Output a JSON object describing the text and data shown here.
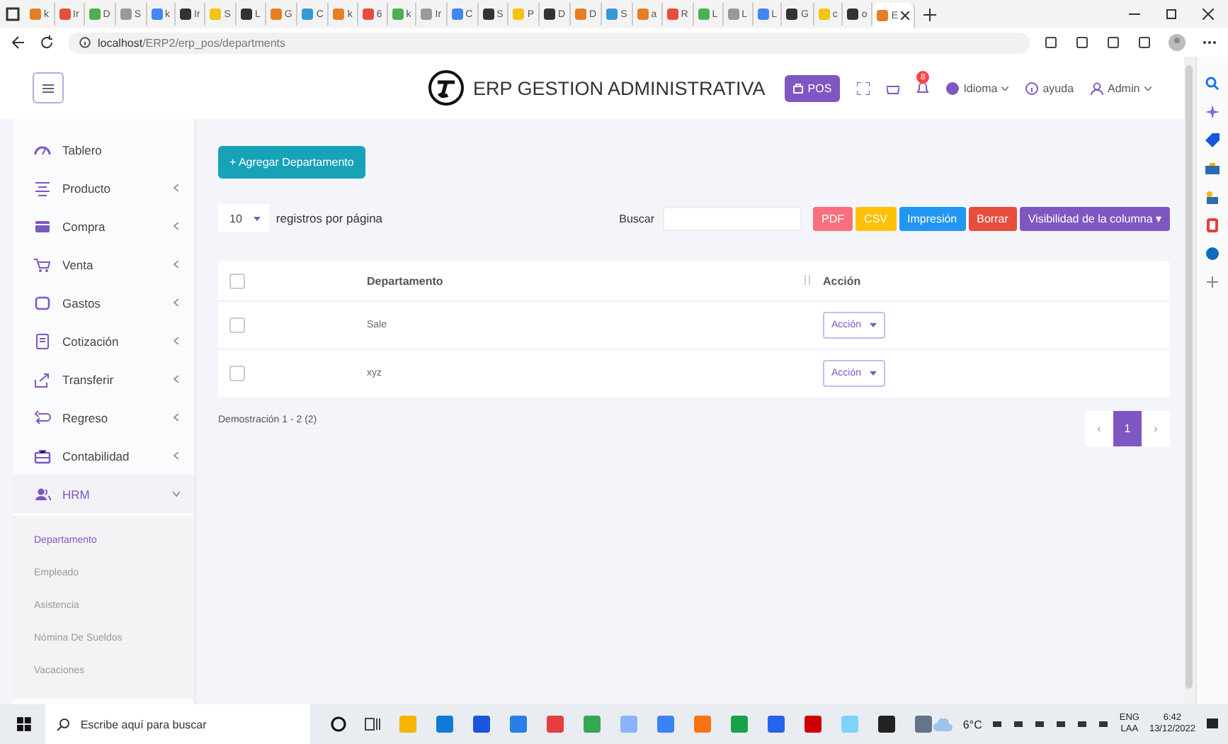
{
  "browser": {
    "tabs": [
      {
        "label": "k",
        "selected": false
      },
      {
        "label": "Ir",
        "selected": false
      },
      {
        "label": "D",
        "selected": false
      },
      {
        "label": "S",
        "selected": false
      },
      {
        "label": "k",
        "selected": false
      },
      {
        "label": "Ir",
        "selected": false
      },
      {
        "label": "S",
        "selected": false
      },
      {
        "label": "L",
        "selected": false
      },
      {
        "label": "G",
        "selected": false
      },
      {
        "label": "C",
        "selected": false
      },
      {
        "label": "k",
        "selected": false
      },
      {
        "label": "6",
        "selected": false
      },
      {
        "label": "k",
        "selected": false
      },
      {
        "label": "Ir",
        "selected": false
      },
      {
        "label": "C",
        "selected": false
      },
      {
        "label": "S",
        "selected": false
      },
      {
        "label": "P",
        "selected": false
      },
      {
        "label": "D",
        "selected": false
      },
      {
        "label": "D",
        "selected": false
      },
      {
        "label": "S",
        "selected": false
      },
      {
        "label": "a",
        "selected": false
      },
      {
        "label": "R",
        "selected": false
      },
      {
        "label": "L",
        "selected": false
      },
      {
        "label": "L",
        "selected": false
      },
      {
        "label": "L",
        "selected": false
      },
      {
        "label": "G",
        "selected": false
      },
      {
        "label": "c",
        "selected": false
      },
      {
        "label": "o",
        "selected": false
      },
      {
        "label": "E",
        "selected": true
      }
    ],
    "url_host": "localhost",
    "url_path": "/ERP2/erp_pos/departments"
  },
  "header": {
    "title": "ERP GESTION ADMINISTRATIVA",
    "pos_button": "POS",
    "notification_count": "8",
    "language": "Idioma",
    "help": "ayuda",
    "user": "Admin"
  },
  "sidebar": {
    "items": [
      {
        "label": "Tablero"
      },
      {
        "label": "Producto",
        "expanded": false
      },
      {
        "label": "Compra",
        "expanded": false
      },
      {
        "label": "Venta",
        "expanded": false
      },
      {
        "label": "Gastos",
        "expanded": false
      },
      {
        "label": "Cotización",
        "expanded": false
      },
      {
        "label": "Transferir",
        "expanded": false
      },
      {
        "label": "Regreso",
        "expanded": false
      },
      {
        "label": "Contabilidad",
        "expanded": false
      },
      {
        "label": "HRM",
        "expanded": true,
        "children": [
          {
            "label": "Departamento",
            "selected": true
          },
          {
            "label": "Empleado",
            "selected": false
          },
          {
            "label": "Asistencia",
            "selected": false
          },
          {
            "label": "Nómina De Sueldos",
            "selected": false
          },
          {
            "label": "Vacaciones",
            "selected": false
          }
        ]
      }
    ]
  },
  "content": {
    "add_button": "+ Agregar Departamento",
    "page_size": "10",
    "page_size_label": "registros por página",
    "search_label": "Buscar",
    "export_buttons": [
      {
        "label": "PDF",
        "color": "#f8707e"
      },
      {
        "label": "CSV",
        "color": "#ffc107"
      },
      {
        "label": "Impresión",
        "color": "#2196f3"
      },
      {
        "label": "Borrar",
        "color": "#e74c3c"
      },
      {
        "label": "Visibilidad de la columna ▾",
        "color": "#7e57c2"
      }
    ],
    "table": {
      "select_all_checked": false,
      "columns": [
        "Departamento",
        "Acción"
      ],
      "rows": [
        {
          "name": "Sale",
          "action": "Acción",
          "checked": false
        },
        {
          "name": "xyz",
          "action": "Acción",
          "checked": false
        }
      ]
    },
    "info": "Demostración 1 - 2 (2)",
    "pagination": {
      "prev": "‹",
      "pages": [
        {
          "label": "1",
          "selected": true
        }
      ],
      "next": "›"
    }
  },
  "taskbar": {
    "search_placeholder": "Escribe aquí para buscar",
    "weather": "6°C",
    "language": "ENG",
    "keyboard": "LAA",
    "time": "6:42",
    "date": "13/12/2022"
  }
}
